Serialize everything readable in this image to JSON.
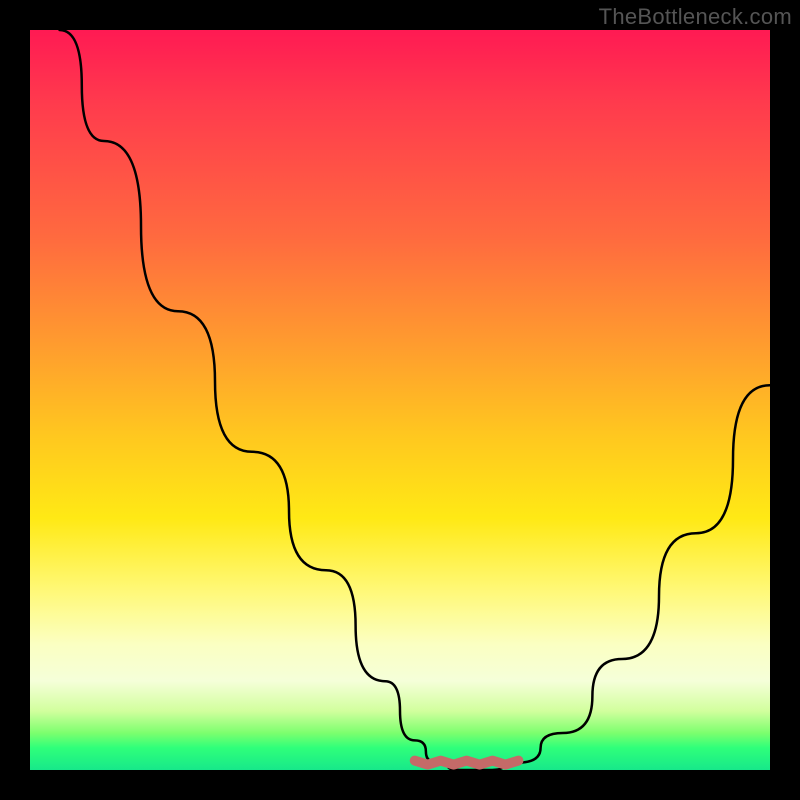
{
  "watermark": "TheBottleneck.com",
  "chart_data": {
    "type": "line",
    "title": "",
    "xlabel": "",
    "ylabel": "",
    "xlim": [
      0,
      100
    ],
    "ylim": [
      0,
      100
    ],
    "series": [
      {
        "name": "curve",
        "x": [
          4,
          10,
          20,
          30,
          40,
          48,
          52,
          55,
          58,
          62,
          66,
          72,
          80,
          90,
          100
        ],
        "values": [
          100,
          85,
          62,
          43,
          27,
          12,
          4,
          1,
          0,
          0,
          1,
          5,
          15,
          32,
          52
        ]
      }
    ],
    "flat_segment": {
      "x_start": 52,
      "x_end": 66,
      "y": 1,
      "color": "#c46a68"
    },
    "gradient_stops": [
      {
        "pos": 0,
        "color": "#ff1a53"
      },
      {
        "pos": 10,
        "color": "#ff3b4d"
      },
      {
        "pos": 28,
        "color": "#ff6a3f"
      },
      {
        "pos": 42,
        "color": "#ff9a2f"
      },
      {
        "pos": 55,
        "color": "#ffc81f"
      },
      {
        "pos": 66,
        "color": "#ffe915"
      },
      {
        "pos": 76,
        "color": "#fff97a"
      },
      {
        "pos": 83,
        "color": "#fbffc2"
      },
      {
        "pos": 88,
        "color": "#f5ffd9"
      },
      {
        "pos": 92,
        "color": "#d2ff9e"
      },
      {
        "pos": 95,
        "color": "#7cff6e"
      },
      {
        "pos": 97,
        "color": "#2fff7a"
      },
      {
        "pos": 100,
        "color": "#17e88a"
      }
    ]
  }
}
